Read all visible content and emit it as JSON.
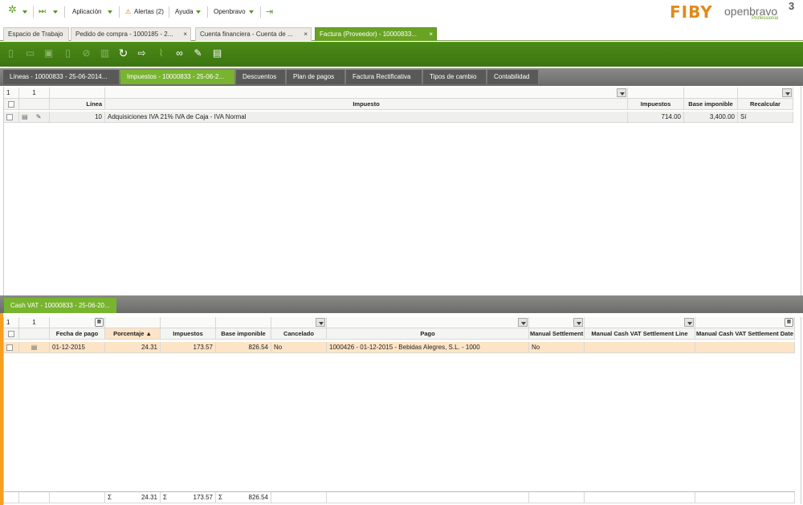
{
  "topnav": {
    "application": "Aplicación",
    "alerts": "Alertas (2)",
    "help": "Ayuda",
    "user": "Openbravo",
    "brand_logo_text": "FIBY",
    "openbravo_text": "openbravo",
    "openbravo_version": "3",
    "openbravo_edition": "Professional"
  },
  "window_tabs": [
    {
      "label": "Espacio de Trabajo"
    },
    {
      "label": "Pedido de compra - 1000185 - 2..."
    },
    {
      "label": "Cuenta financiera - Cuenta de ..."
    },
    {
      "label": "Factura (Proveedor) - 10000833..."
    }
  ],
  "close_glyph": "×",
  "sub_tabs": [
    {
      "label": "Líneas - 10000833 - 25-06-2014..."
    },
    {
      "label": "Impuestos - 10000833 - 25-06-2..."
    },
    {
      "label": "Descuentos"
    },
    {
      "label": "Plan de pagos"
    },
    {
      "label": "Factura Rectificativa"
    },
    {
      "label": "Tipos de cambio"
    },
    {
      "label": "Contabilidad"
    }
  ],
  "taxes_grid": {
    "filter_count_a": "1",
    "filter_count_b": "1",
    "headers": {
      "line": "Línea",
      "tax": "Impuesto",
      "taxes": "Impuestos",
      "base": "Base imponible",
      "recalc": "Recalcular"
    },
    "rows": [
      {
        "line": "10",
        "tax": "Adquisiciones IVA 21% IVA de Caja - IVA Normal",
        "taxes": "714.00",
        "base": "3,400.00",
        "recalc": "Sí"
      }
    ]
  },
  "cashvat_tab": {
    "label": "Cash VAT - 10000833 - 25-06-20..."
  },
  "cashvat_grid": {
    "filter_count_a": "1",
    "filter_count_b": "1",
    "headers": {
      "date": "Fecha de pago",
      "pct": "Porcentaje ▲",
      "taxes": "Impuestos",
      "base": "Base imponible",
      "cancelled": "Cancelado",
      "payment": "Pago",
      "manual": "Manual Settlement",
      "manual_line": "Manual Cash VAT Settlement Line",
      "manual_date": "Manual Cash VAT Settlement Date"
    },
    "rows": [
      {
        "date": "01-12-2015",
        "pct": "24.31",
        "taxes": "173.57",
        "base": "826.54",
        "cancelled": "No",
        "payment": "1000426 - 01-12-2015 - Bebidas Alegres, S.L. - 1000",
        "manual": "No"
      }
    ],
    "summary": {
      "sigma": "Σ",
      "pct": "24.31",
      "taxes": "173.57",
      "base": "826.54"
    }
  },
  "colors": {
    "accent_green": "#6aa324",
    "toolbar_green": "#3c7510",
    "orange": "#f5a021"
  }
}
